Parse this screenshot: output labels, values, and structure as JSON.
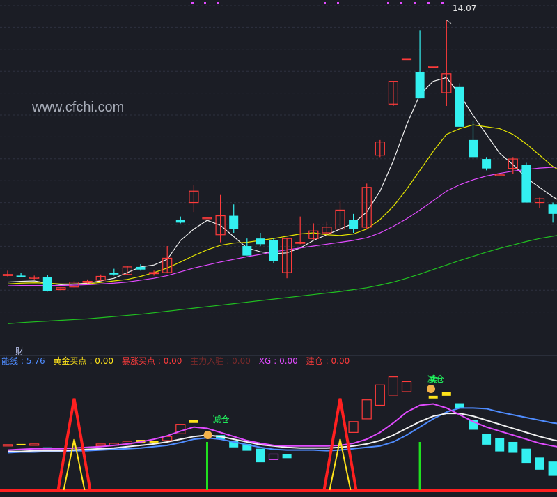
{
  "watermark": "www.cfchi.com",
  "sub_panel_title": "财",
  "high_label": "14.07",
  "indicators": [
    {
      "name": "能线",
      "value": "5.76",
      "color": "#4f8cff"
    },
    {
      "name": "黄金买点",
      "value": "0.00",
      "color": "#ffe31a"
    },
    {
      "name": "暴涨买点",
      "value": "0.00",
      "color": "#ff3b3b"
    },
    {
      "name": "主力入驻",
      "value": "0.00",
      "color": "#7a2a2a"
    },
    {
      "name": "XG",
      "value": "0.00",
      "color": "#e14bff"
    },
    {
      "name": "建仓",
      "value": "0.00",
      "color": "#ff3b3b"
    }
  ],
  "signal_labels": {
    "reduce": "减仓",
    "sell": "卖"
  },
  "colors": {
    "bg": "#1b1d25",
    "up": "#ff3b3b",
    "down": "#33f0f0",
    "ma5": "#f2f2f2",
    "ma10": "#e6e600",
    "ma20": "#e14bff",
    "ma60": "#20c020"
  },
  "chart_data": [
    {
      "type": "candlestick",
      "title": "",
      "candles": [
        {
          "o": 7.35,
          "h": 7.45,
          "l": 7.3,
          "c": 7.35
        },
        {
          "o": 7.32,
          "h": 7.4,
          "l": 7.28,
          "c": 7.28
        },
        {
          "o": 7.25,
          "h": 7.32,
          "l": 7.22,
          "c": 7.28
        },
        {
          "o": 7.28,
          "h": 7.34,
          "l": 6.9,
          "c": 6.92
        },
        {
          "o": 6.95,
          "h": 7.02,
          "l": 6.93,
          "c": 7.0
        },
        {
          "o": 7.02,
          "h": 7.18,
          "l": 7.0,
          "c": 7.15
        },
        {
          "o": 7.15,
          "h": 7.22,
          "l": 7.12,
          "c": 7.17
        },
        {
          "o": 7.2,
          "h": 7.35,
          "l": 7.18,
          "c": 7.3
        },
        {
          "o": 7.4,
          "h": 7.5,
          "l": 7.32,
          "c": 7.35
        },
        {
          "o": 7.35,
          "h": 7.58,
          "l": 7.33,
          "c": 7.55
        },
        {
          "o": 7.55,
          "h": 7.62,
          "l": 7.45,
          "c": 7.48
        },
        {
          "o": 7.38,
          "h": 7.45,
          "l": 7.32,
          "c": 7.4
        },
        {
          "o": 7.4,
          "h": 8.1,
          "l": 7.38,
          "c": 7.78
        },
        {
          "o": 8.8,
          "h": 8.88,
          "l": 8.7,
          "c": 8.72
        },
        {
          "o": 9.25,
          "h": 9.7,
          "l": 9.0,
          "c": 9.55
        },
        {
          "o": 8.85,
          "h": 8.86,
          "l": 8.84,
          "c": 8.85
        },
        {
          "o": 8.4,
          "h": 9.45,
          "l": 8.2,
          "c": 8.9
        },
        {
          "o": 8.9,
          "h": 9.2,
          "l": 8.45,
          "c": 8.55
        },
        {
          "o": 8.1,
          "h": 8.3,
          "l": 7.85,
          "c": 7.85
        },
        {
          "o": 8.3,
          "h": 8.45,
          "l": 8.1,
          "c": 8.15
        },
        {
          "o": 8.25,
          "h": 8.3,
          "l": 7.65,
          "c": 7.7
        },
        {
          "o": 7.4,
          "h": 8.3,
          "l": 7.25,
          "c": 8.3
        },
        {
          "o": 8.2,
          "h": 8.88,
          "l": 8.15,
          "c": 8.2
        },
        {
          "o": 8.3,
          "h": 8.7,
          "l": 8.25,
          "c": 8.5
        },
        {
          "o": 8.45,
          "h": 8.75,
          "l": 8.4,
          "c": 8.6
        },
        {
          "o": 8.55,
          "h": 9.3,
          "l": 8.5,
          "c": 9.05
        },
        {
          "o": 8.8,
          "h": 8.95,
          "l": 8.45,
          "c": 8.55
        },
        {
          "o": 8.6,
          "h": 9.75,
          "l": 8.55,
          "c": 9.65
        },
        {
          "o": 10.5,
          "h": 10.9,
          "l": 10.45,
          "c": 10.85
        },
        {
          "o": 11.85,
          "h": 12.45,
          "l": 11.8,
          "c": 12.45
        },
        {
          "o": 13.05,
          "h": 13.05,
          "l": 13.05,
          "c": 13.05
        },
        {
          "o": 12.7,
          "h": 13.8,
          "l": 12.0,
          "c": 12.0
        },
        {
          "o": 12.85,
          "h": 12.86,
          "l": 12.84,
          "c": 12.85
        },
        {
          "o": 12.15,
          "h": 14.07,
          "l": 11.8,
          "c": 12.65
        },
        {
          "o": 12.3,
          "h": 12.4,
          "l": 11.25,
          "c": 11.25
        },
        {
          "o": 10.9,
          "h": 11.4,
          "l": 10.45,
          "c": 10.45
        },
        {
          "o": 10.4,
          "h": 10.45,
          "l": 10.1,
          "c": 10.15
        },
        {
          "o": 9.98,
          "h": 9.99,
          "l": 9.97,
          "c": 9.98
        },
        {
          "o": 10.15,
          "h": 10.45,
          "l": 10.0,
          "c": 10.4
        },
        {
          "o": 10.25,
          "h": 10.3,
          "l": 9.25,
          "c": 9.25
        },
        {
          "o": 9.25,
          "h": 9.38,
          "l": 9.1,
          "c": 9.35
        },
        {
          "o": 9.2,
          "h": 9.25,
          "l": 8.72,
          "c": 8.95
        },
        {
          "o": 9.0,
          "h": 9.25,
          "l": 8.95,
          "c": 9.1
        }
      ],
      "overlays": [
        {
          "name": "MA5",
          "color": "#f2f2f2",
          "values": [
            7.15,
            7.17,
            7.18,
            7.12,
            7.08,
            7.1,
            7.12,
            7.18,
            7.25,
            7.4,
            7.55,
            7.6,
            7.75,
            8.25,
            8.55,
            8.78,
            8.65,
            8.35,
            8.05,
            7.95,
            7.9,
            7.92,
            8.05,
            8.25,
            8.4,
            8.55,
            8.7,
            9.0,
            9.55,
            10.35,
            11.3,
            12.1,
            12.45,
            12.55,
            12.1,
            11.55,
            11.05,
            10.55,
            10.25,
            9.9,
            9.65,
            9.4,
            9.2
          ]
        },
        {
          "name": "MA10",
          "color": "#e6e600",
          "values": [
            7.1,
            7.12,
            7.13,
            7.12,
            7.1,
            7.1,
            7.1,
            7.14,
            7.18,
            7.22,
            7.3,
            7.4,
            7.52,
            7.68,
            7.85,
            8.0,
            8.12,
            8.18,
            8.2,
            8.25,
            8.3,
            8.36,
            8.42,
            8.45,
            8.4,
            8.38,
            8.42,
            8.55,
            8.8,
            9.15,
            9.6,
            10.1,
            10.6,
            11.05,
            11.2,
            11.3,
            11.25,
            11.2,
            11.05,
            10.8,
            10.5,
            10.2,
            10.0
          ]
        },
        {
          "name": "MA20",
          "color": "#e14bff",
          "values": [
            7.05,
            7.06,
            7.06,
            7.06,
            7.06,
            7.07,
            7.08,
            7.1,
            7.12,
            7.15,
            7.2,
            7.25,
            7.32,
            7.42,
            7.52,
            7.6,
            7.68,
            7.75,
            7.82,
            7.88,
            7.95,
            8.0,
            8.05,
            8.1,
            8.15,
            8.2,
            8.25,
            8.32,
            8.45,
            8.62,
            8.82,
            9.05,
            9.3,
            9.55,
            9.72,
            9.85,
            9.95,
            10.02,
            10.08,
            10.12,
            10.16,
            10.18,
            10.2
          ]
        },
        {
          "name": "MA60",
          "color": "#20c020",
          "values": [
            6.05,
            6.08,
            6.1,
            6.12,
            6.14,
            6.16,
            6.18,
            6.21,
            6.24,
            6.27,
            6.3,
            6.34,
            6.38,
            6.42,
            6.46,
            6.5,
            6.54,
            6.58,
            6.62,
            6.66,
            6.7,
            6.74,
            6.78,
            6.82,
            6.86,
            6.9,
            6.95,
            7.0,
            7.07,
            7.15,
            7.25,
            7.36,
            7.48,
            7.6,
            7.72,
            7.83,
            7.94,
            8.04,
            8.13,
            8.22,
            8.3,
            8.36,
            8.42
          ]
        }
      ],
      "ylim": [
        5.8,
        14.45
      ]
    },
    {
      "type": "bar",
      "title": "",
      "bars": [
        {
          "i": 0,
          "lo": 0.3,
          "hi": 0.32,
          "c": "#ff3b3b"
        },
        {
          "i": 1,
          "lo": 0.31,
          "hi": 0.33,
          "c": "#ffe31a"
        },
        {
          "i": 2,
          "lo": 0.31,
          "hi": 0.33,
          "c": "#ff3b3b"
        },
        {
          "i": 3,
          "lo": 0.25,
          "hi": 0.28,
          "c": "#33f0f0"
        },
        {
          "i": 7,
          "lo": 0.3,
          "hi": 0.33,
          "c": "#ff3b3b"
        },
        {
          "i": 8,
          "lo": 0.31,
          "hi": 0.34,
          "c": "#ff3b3b"
        },
        {
          "i": 9,
          "lo": 0.33,
          "hi": 0.37,
          "c": "#ff3b3b"
        },
        {
          "i": 10,
          "lo": 0.35,
          "hi": 0.39,
          "c": "#ffe31a"
        },
        {
          "i": 11,
          "lo": 0.35,
          "hi": 0.38,
          "c": "#ffe31a"
        },
        {
          "i": 12,
          "lo": 0.38,
          "hi": 0.44,
          "c": "#ff3b3b"
        },
        {
          "i": 13,
          "lo": 0.48,
          "hi": 0.62,
          "c": "#ff3b3b"
        },
        {
          "i": 14,
          "lo": 0.64,
          "hi": 0.68,
          "c": "#ffe31a"
        },
        {
          "i": 16,
          "lo": 0.4,
          "hi": 0.46,
          "c": "#33f0f0"
        },
        {
          "i": 17,
          "lo": 0.28,
          "hi": 0.38,
          "c": "#33f0f0"
        },
        {
          "i": 18,
          "lo": 0.23,
          "hi": 0.33,
          "c": "#33f0f0"
        },
        {
          "i": 19,
          "lo": 0.06,
          "hi": 0.26,
          "c": "#33f0f0"
        },
        {
          "i": 20,
          "lo": 0.1,
          "hi": 0.18,
          "c": "#e14bff"
        },
        {
          "i": 21,
          "lo": 0.12,
          "hi": 0.18,
          "c": "#33f0f0"
        },
        {
          "i": 26,
          "lo": 0.5,
          "hi": 0.66,
          "c": "#ff3b3b"
        },
        {
          "i": 27,
          "lo": 0.7,
          "hi": 0.98,
          "c": "#ff3b3b"
        },
        {
          "i": 28,
          "lo": 0.9,
          "hi": 1.2,
          "c": "#ff3b3b"
        },
        {
          "i": 29,
          "lo": 1.05,
          "hi": 1.32,
          "c": "#ff3b3b"
        },
        {
          "i": 30,
          "lo": 1.1,
          "hi": 1.25,
          "c": "#ff3b3b"
        },
        {
          "i": 32,
          "lo": 1.0,
          "hi": 1.04,
          "c": "#ffe31a"
        },
        {
          "i": 33,
          "lo": 1.04,
          "hi": 1.09,
          "c": "#ffe31a"
        },
        {
          "i": 34,
          "lo": 0.86,
          "hi": 0.93,
          "c": "#33f0f0"
        },
        {
          "i": 35,
          "lo": 0.54,
          "hi": 0.68,
          "c": "#33f0f0"
        },
        {
          "i": 36,
          "lo": 0.32,
          "hi": 0.48,
          "c": "#33f0f0"
        },
        {
          "i": 37,
          "lo": 0.22,
          "hi": 0.42,
          "c": "#33f0f0"
        },
        {
          "i": 38,
          "lo": 0.2,
          "hi": 0.36,
          "c": "#33f0f0"
        },
        {
          "i": 39,
          "lo": 0.05,
          "hi": 0.26,
          "c": "#33f0f0"
        },
        {
          "i": 40,
          "lo": -0.05,
          "hi": 0.13,
          "c": "#33f0f0"
        },
        {
          "i": 41,
          "lo": -0.14,
          "hi": 0.07,
          "c": "#33f0f0"
        }
      ],
      "lines": [
        {
          "name": "能线",
          "color": "#4f8cff",
          "values": [
            0.2,
            0.21,
            0.21,
            0.22,
            0.22,
            0.23,
            0.23,
            0.24,
            0.25,
            0.26,
            0.27,
            0.29,
            0.31,
            0.35,
            0.4,
            0.42,
            0.4,
            0.36,
            0.32,
            0.28,
            0.25,
            0.24,
            0.24,
            0.24,
            0.23,
            0.24,
            0.26,
            0.28,
            0.3,
            0.36,
            0.46,
            0.58,
            0.7,
            0.8,
            0.86,
            0.86,
            0.85,
            0.8,
            0.76,
            0.72,
            0.68,
            0.64,
            0.62
          ]
        },
        {
          "name": "白线",
          "color": "#f2f2f2",
          "values": [
            0.22,
            0.22,
            0.23,
            0.23,
            0.23,
            0.24,
            0.25,
            0.26,
            0.27,
            0.29,
            0.31,
            0.33,
            0.36,
            0.4,
            0.44,
            0.46,
            0.44,
            0.4,
            0.36,
            0.32,
            0.3,
            0.28,
            0.27,
            0.27,
            0.27,
            0.28,
            0.3,
            0.33,
            0.38,
            0.46,
            0.56,
            0.66,
            0.74,
            0.78,
            0.78,
            0.74,
            0.68,
            0.62,
            0.56,
            0.5,
            0.44,
            0.39,
            0.35
          ]
        },
        {
          "name": "紫线",
          "color": "#e14bff",
          "values": [
            0.24,
            0.25,
            0.26,
            0.26,
            0.26,
            0.27,
            0.28,
            0.29,
            0.31,
            0.33,
            0.36,
            0.4,
            0.45,
            0.52,
            0.58,
            0.56,
            0.5,
            0.44,
            0.38,
            0.34,
            0.31,
            0.3,
            0.3,
            0.3,
            0.3,
            0.31,
            0.34,
            0.4,
            0.5,
            0.64,
            0.8,
            0.9,
            0.92,
            0.86,
            0.76,
            0.66,
            0.58,
            0.52,
            0.46,
            0.4,
            0.34,
            0.3,
            0.27
          ]
        }
      ],
      "spikes": [
        {
          "i": 5,
          "value": 1.0
        },
        {
          "i": 25,
          "value": 1.0
        }
      ],
      "signals": [
        {
          "i": 15,
          "value": 0.36
        },
        {
          "i": 31,
          "value": 0.36
        }
      ],
      "ylim": [
        -0.35,
        1.45
      ]
    }
  ]
}
